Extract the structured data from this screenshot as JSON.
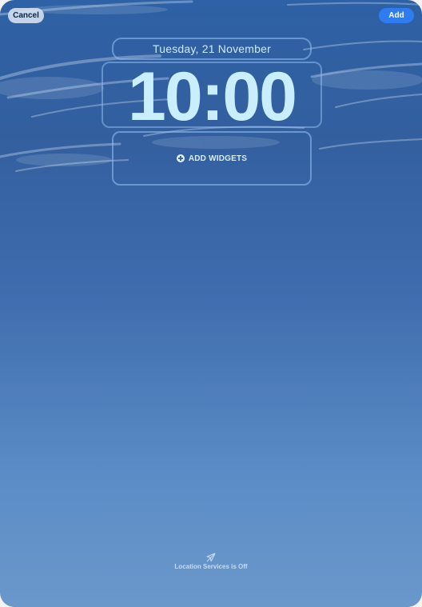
{
  "header": {
    "cancel_label": "Cancel",
    "add_label": "Add"
  },
  "lock_screen": {
    "date": "Tuesday, 21 November",
    "time": "10:00",
    "widgets_label": "ADD WIDGETS"
  },
  "footer": {
    "location_status": "Location Services is Off"
  },
  "icons": {
    "widgets": "plus-circle-icon",
    "location": "location-arrow-icon"
  },
  "colors": {
    "accent": "#2f7cf0",
    "clock_text": "#c9efff"
  }
}
